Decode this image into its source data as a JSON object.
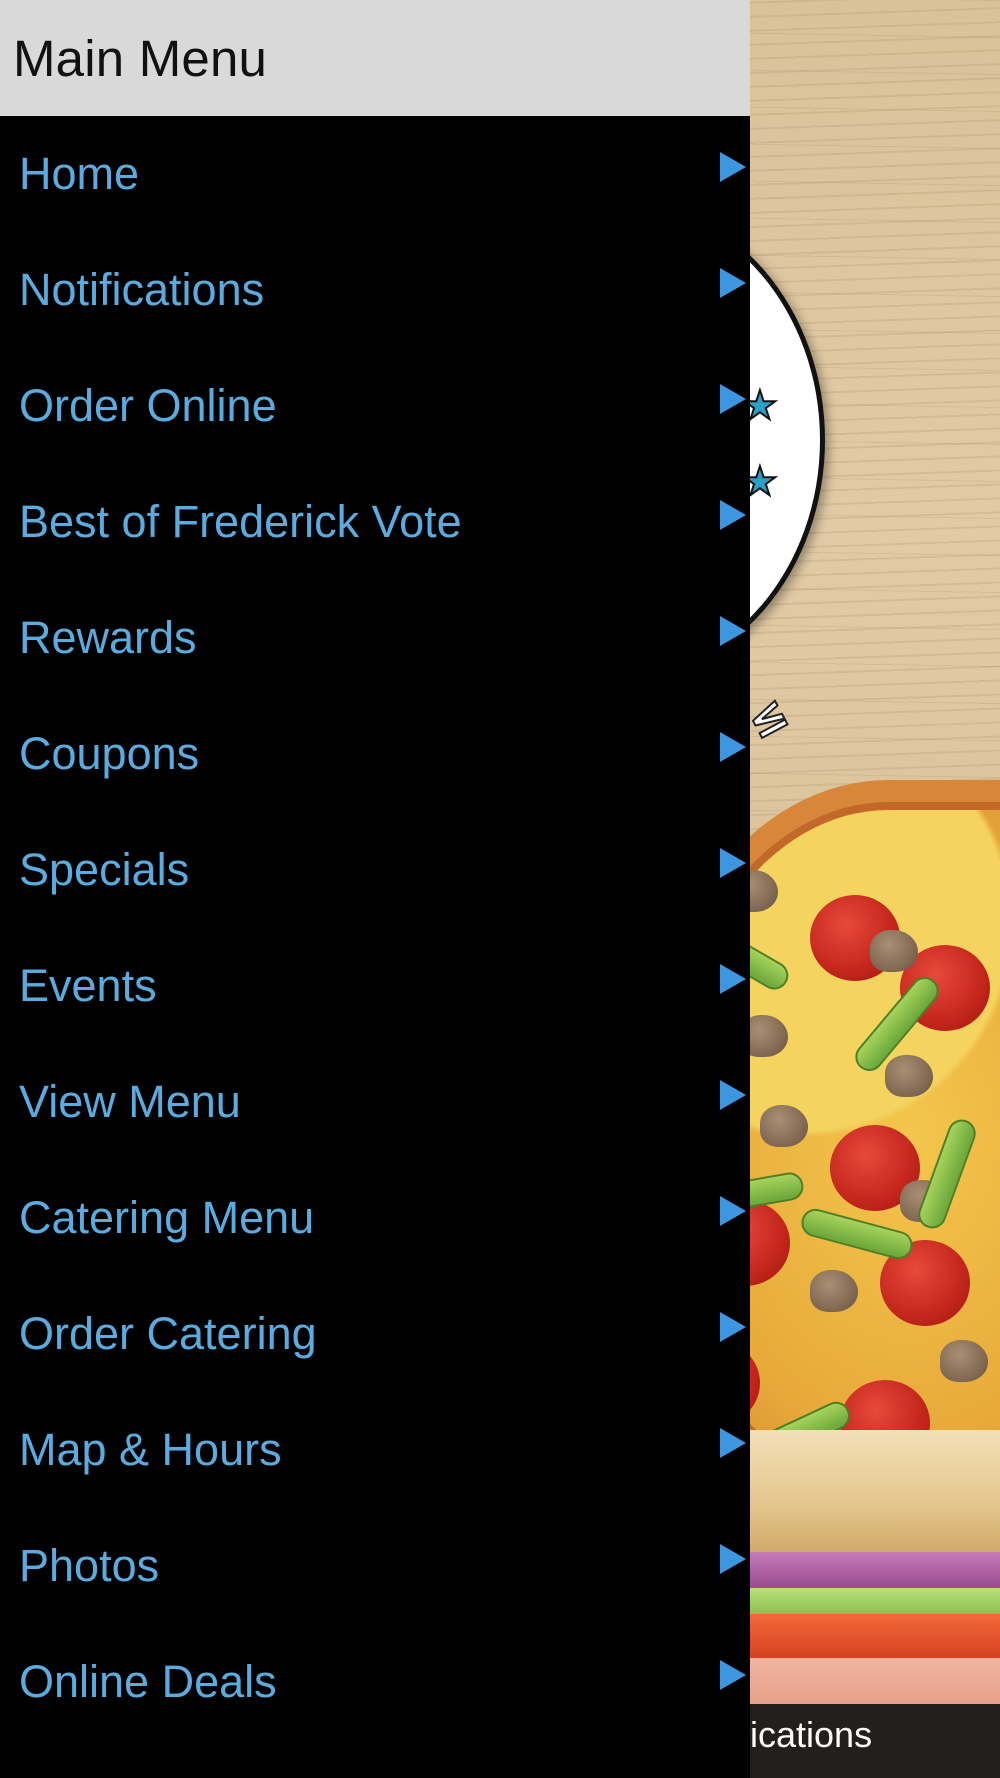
{
  "drawer": {
    "title": "Main Menu",
    "items": [
      {
        "label": "Home",
        "icon": "chevron-right-icon"
      },
      {
        "label": "Notifications",
        "icon": "chevron-right-icon"
      },
      {
        "label": "Order Online",
        "icon": "chevron-right-icon"
      },
      {
        "label": "Best of Frederick Vote",
        "icon": "chevron-right-icon"
      },
      {
        "label": "Rewards",
        "icon": "chevron-right-icon"
      },
      {
        "label": "Coupons",
        "icon": "chevron-right-icon"
      },
      {
        "label": "Specials",
        "icon": "chevron-right-icon"
      },
      {
        "label": "Events",
        "icon": "chevron-right-icon"
      },
      {
        "label": "View Menu",
        "icon": "chevron-right-icon"
      },
      {
        "label": "Catering Menu",
        "icon": "chevron-right-icon"
      },
      {
        "label": "Order Catering",
        "icon": "chevron-right-icon"
      },
      {
        "label": "Map & Hours",
        "icon": "chevron-right-icon"
      },
      {
        "label": "Photos",
        "icon": "chevron-right-icon"
      },
      {
        "label": "Online Deals",
        "icon": "chevron-right-icon"
      }
    ]
  },
  "background_app": {
    "bottom_tab_label": "ifications"
  },
  "colors": {
    "drawer_background": "#000000",
    "header_background": "#d9d9d9",
    "menu_text": "#5aace0",
    "arrow": "#3d96e0",
    "tabbar_background": "#231f1c"
  }
}
